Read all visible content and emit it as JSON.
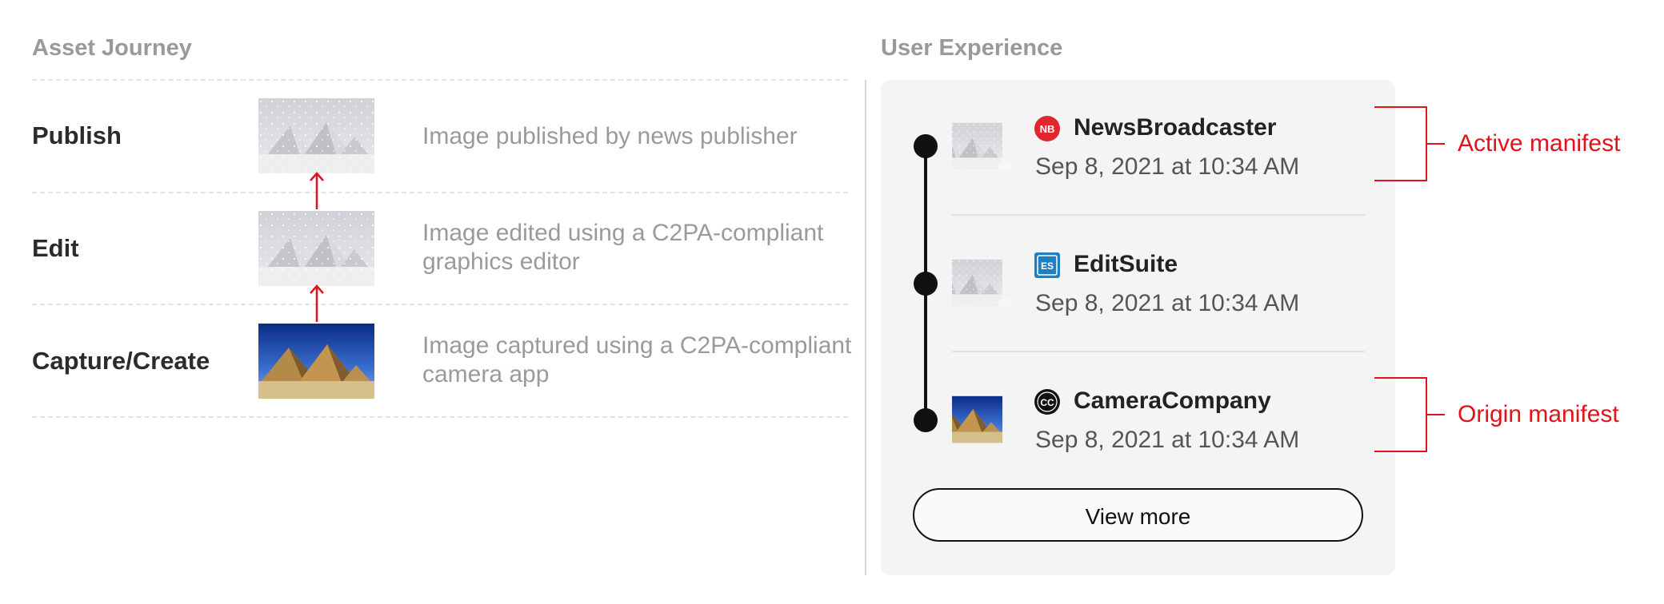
{
  "headers": {
    "asset_journey": "Asset Journey",
    "user_experience": "User Experience"
  },
  "journey": [
    {
      "stage": "Publish",
      "description": "Image published by news publisher",
      "thumbnail": "snowy-pyramids"
    },
    {
      "stage": "Edit",
      "description": "Image edited using a C2PA-compliant graphics editor",
      "thumbnail": "snowy-pyramids"
    },
    {
      "stage": "Capture/Create",
      "description": "Image captured using a C2PA-compliant camera app",
      "thumbnail": "desert-pyramids"
    }
  ],
  "manifests": [
    {
      "logo_text": "NB",
      "logo_color": "#e3262e",
      "name": "NewsBroadcaster",
      "date": "Sep 8, 2021 at 10:34 AM",
      "thumbnail": "snowy-pyramids-bear"
    },
    {
      "logo_text": "ES",
      "logo_color": "#1f7fc4",
      "name": "EditSuite",
      "date": "Sep 8, 2021 at 10:34 AM",
      "thumbnail": "snowy-pyramids-bear"
    },
    {
      "logo_text": "CC",
      "logo_color": "#111111",
      "name": "CameraCompany",
      "date": "Sep 8, 2021 at 10:34 AM",
      "thumbnail": "desert-pyramids"
    }
  ],
  "view_more_label": "View more",
  "annotations": {
    "active": "Active manifest",
    "origin": "Origin manifest"
  },
  "colors": {
    "accent": "#e0121a",
    "header": "#999999",
    "panel": "#f4f4f4"
  }
}
